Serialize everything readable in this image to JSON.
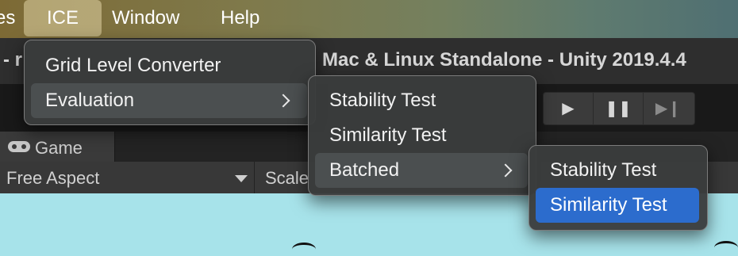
{
  "menubar": {
    "items": [
      "es",
      "ICE",
      "Window",
      "Help"
    ]
  },
  "titlebar": {
    "left_fragment": "- r",
    "title": "Mac & Linux Standalone - Unity 2019.4.4"
  },
  "toolbar": {
    "play_icons": [
      "play-icon",
      "pause-icon",
      "step-icon"
    ]
  },
  "game_tab": {
    "label": "Game",
    "icon": "gamepad-icon"
  },
  "game_toolbar": {
    "aspect": "Free Aspect",
    "scale_label": "Scale"
  },
  "ice_menu": {
    "items": [
      {
        "label": "Grid Level Converter",
        "submenu": false
      },
      {
        "label": "Evaluation",
        "submenu": true
      }
    ]
  },
  "evaluation_menu": {
    "items": [
      {
        "label": "Stability Test",
        "submenu": false
      },
      {
        "label": "Similarity Test",
        "submenu": false
      },
      {
        "label": "Batched",
        "submenu": true
      }
    ]
  },
  "batched_menu": {
    "items": [
      {
        "label": "Stability Test"
      },
      {
        "label": "Similarity Test"
      }
    ]
  },
  "colors": {
    "selection": "#2c6ccd",
    "menu_bg": "#3a3c3c",
    "game_view_bg": "#a7e3ea"
  }
}
